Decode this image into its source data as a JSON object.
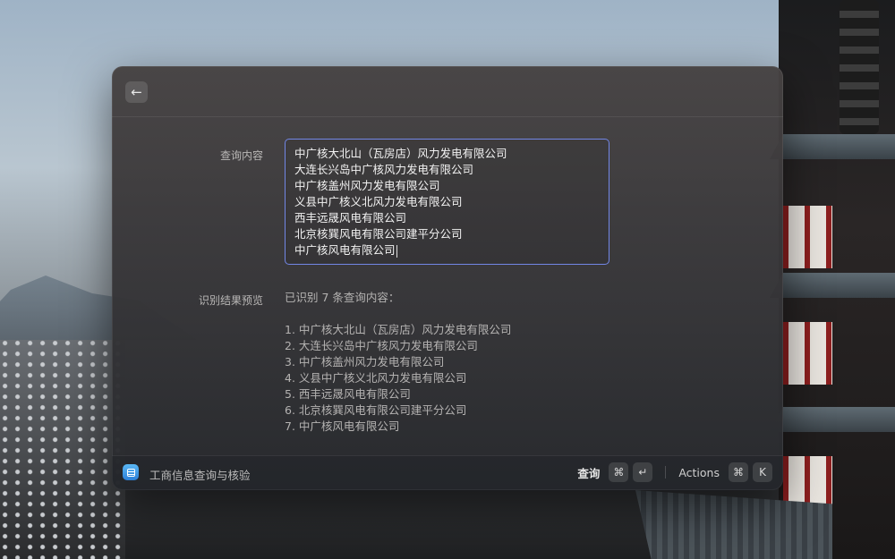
{
  "header": {
    "back_icon": "arrow-left-icon"
  },
  "form": {
    "query_label": "查询内容",
    "query_lines": [
      "中广核大北山（瓦房店）风力发电有限公司",
      "大连长兴岛中广核风力发电有限公司",
      "中广核盖州风力发电有限公司",
      "义县中广核义北风力发电有限公司",
      "西丰远晟风电有限公司",
      "北京核巽风电有限公司建平分公司",
      "中广核风电有限公司"
    ],
    "preview_label": "识别结果预览",
    "preview_header": "已识别 7 条查询内容：",
    "preview_items": [
      "1. 中广核大北山（瓦房店）风力发电有限公司",
      "2. 大连长兴岛中广核风力发电有限公司",
      "3. 中广核盖州风力发电有限公司",
      "4. 义县中广核义北风力发电有限公司",
      "5. 西丰远晟风电有限公司",
      "6. 北京核巽风电有限公司建平分公司",
      "7. 中广核风电有限公司"
    ]
  },
  "footer": {
    "extension_icon": "document-list-icon",
    "extension_name": "工商信息查询与核验",
    "primary_action": "查询",
    "primary_keys": [
      "⌘",
      "↵"
    ],
    "secondary_action": "Actions",
    "secondary_keys": [
      "⌘",
      "K"
    ]
  },
  "colors": {
    "focus_border": "#7287e6",
    "extension_icon": "#3b96e6"
  }
}
